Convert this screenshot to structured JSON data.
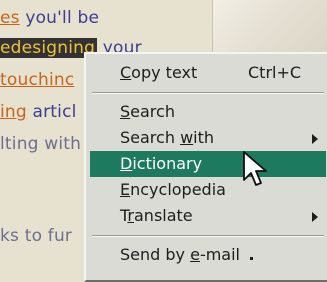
{
  "background_page": {
    "lines": [
      {
        "link": "es",
        "text": " you'll be"
      },
      {
        "highlight": "edesigning",
        "text": " your"
      },
      {
        "link": "touchinc",
        "text": ""
      },
      {
        "link": "ing",
        "text": " articl"
      },
      {
        "text": "lting with"
      },
      {
        "text": "ks to fur"
      }
    ]
  },
  "context_menu": {
    "items": [
      {
        "pre": "",
        "ul": "C",
        "post": "opy text",
        "shortcut": "Ctrl+C",
        "submenu": false
      },
      {
        "pre": "",
        "ul": "S",
        "post": "earch",
        "shortcut": "",
        "submenu": false
      },
      {
        "pre": "Search ",
        "ul": "w",
        "post": "ith",
        "shortcut": "",
        "submenu": true
      },
      {
        "pre": "",
        "ul": "D",
        "post": "ictionary",
        "shortcut": "",
        "submenu": false,
        "highlighted": true
      },
      {
        "pre": "",
        "ul": "E",
        "post": "ncyclopedia",
        "shortcut": "",
        "submenu": false
      },
      {
        "pre": "T",
        "ul": "r",
        "post": "anslate",
        "shortcut": "",
        "submenu": true
      },
      {
        "pre": "Send by ",
        "ul": "e",
        "post": "-mail",
        "shortcut": "",
        "submenu": false
      }
    ]
  },
  "colors": {
    "menu_background": "#dbdbd6",
    "highlight": "#1d7a5f",
    "page_text": "#3b3e8f",
    "page_link": "#c5651e"
  }
}
